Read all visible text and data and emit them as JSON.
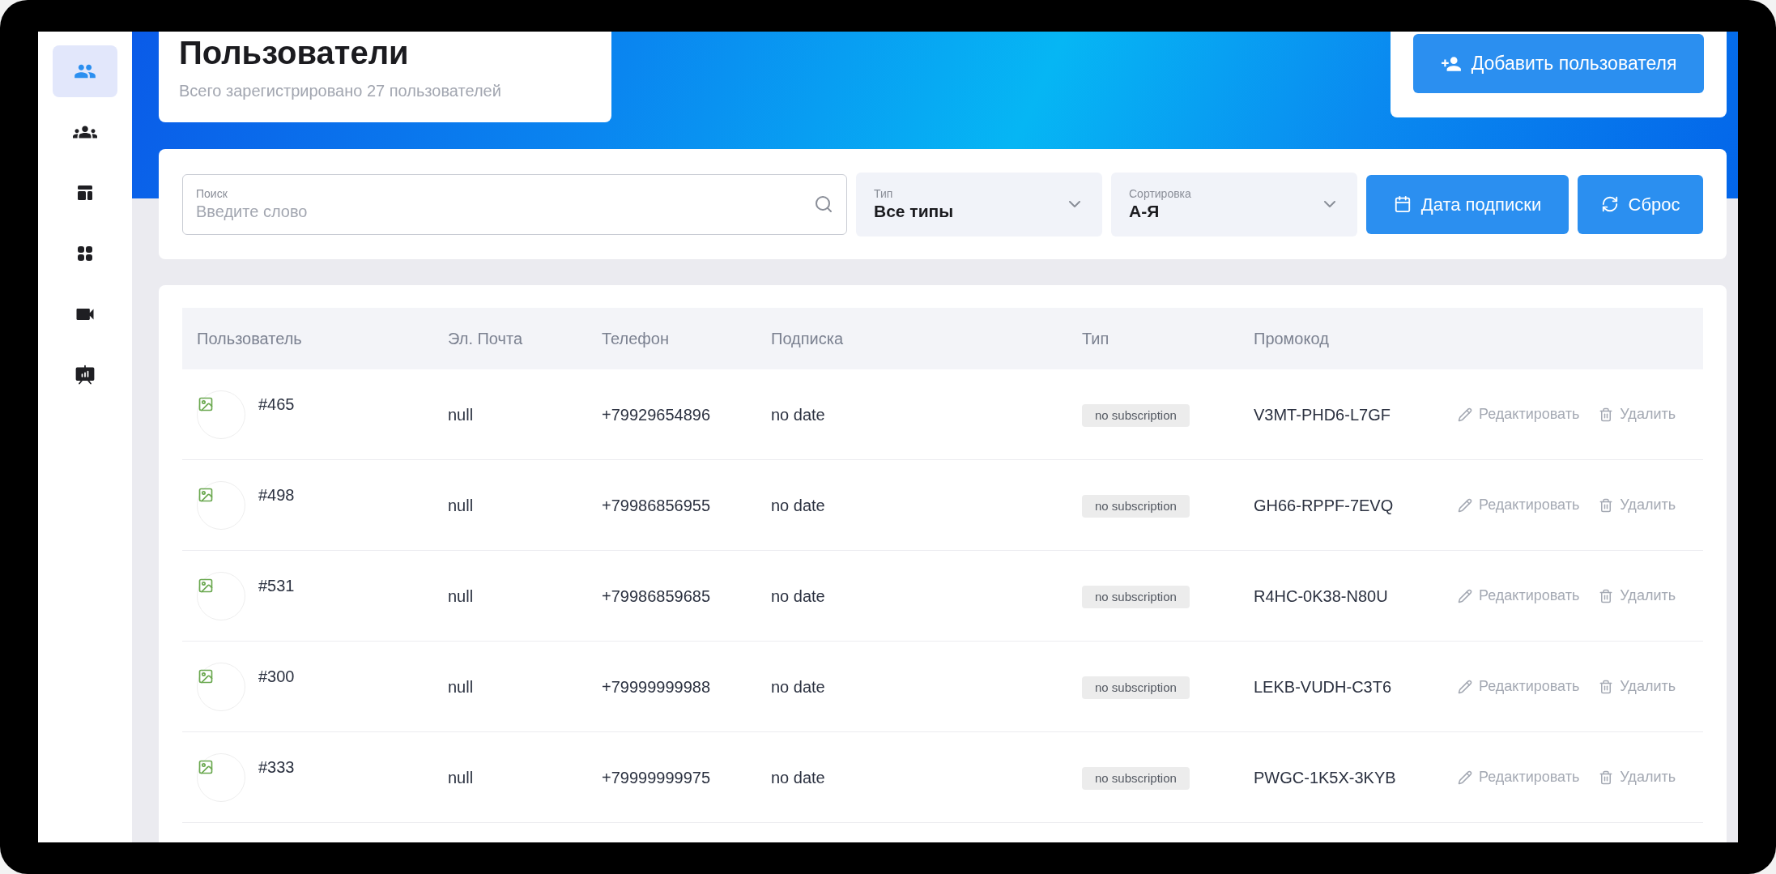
{
  "sidebar": {
    "items": [
      {
        "selected": true
      },
      {
        "selected": false
      },
      {
        "selected": false
      },
      {
        "selected": false
      },
      {
        "selected": false
      },
      {
        "selected": false
      }
    ]
  },
  "header": {
    "title": "Пользователи",
    "subtitle": "Всего зарегистрировано 27 пользователей"
  },
  "add_button": {
    "label": "Добавить пользователя"
  },
  "filters": {
    "search": {
      "label": "Поиск",
      "placeholder": "Введите слово"
    },
    "selects": [
      {
        "label": "Тип",
        "value": "Все типы"
      },
      {
        "label": "Сортировка",
        "value": "А-Я"
      }
    ],
    "buttons": [
      {
        "kind": "date",
        "label": "Дата подписки"
      },
      {
        "kind": "reset",
        "label": "Сброс"
      }
    ]
  },
  "table": {
    "columns": [
      "Пользователь",
      "Эл. Почта",
      "Телефон",
      "Подписка",
      "Тип",
      "Промокод"
    ],
    "rows": [
      {
        "user": "#465",
        "email": "null",
        "phone": "+79929654896",
        "subscription": "no date",
        "type": "no subscription",
        "promo": "V3MT-PHD6-L7GF",
        "edit": "Редактировать",
        "delete": "Удалить"
      },
      {
        "user": "#498",
        "email": "null",
        "phone": "+79986856955",
        "subscription": "no date",
        "type": "no subscription",
        "promo": "GH66-RPPF-7EVQ",
        "edit": "Редактировать",
        "delete": "Удалить"
      },
      {
        "user": "#531",
        "email": "null",
        "phone": "+79986859685",
        "subscription": "no date",
        "type": "no subscription",
        "promo": "R4HC-0K38-N80U",
        "edit": "Редактировать",
        "delete": "Удалить"
      },
      {
        "user": "#300",
        "email": "null",
        "phone": "+79999999988",
        "subscription": "no date",
        "type": "no subscription",
        "promo": "LEKB-VUDH-C3T6",
        "edit": "Редактировать",
        "delete": "Удалить"
      },
      {
        "user": "#333",
        "email": "null",
        "phone": "+79999999975",
        "subscription": "no date",
        "type": "no subscription",
        "promo": "PWGC-1K5X-3KYB",
        "edit": "Редактировать",
        "delete": "Удалить"
      }
    ]
  }
}
